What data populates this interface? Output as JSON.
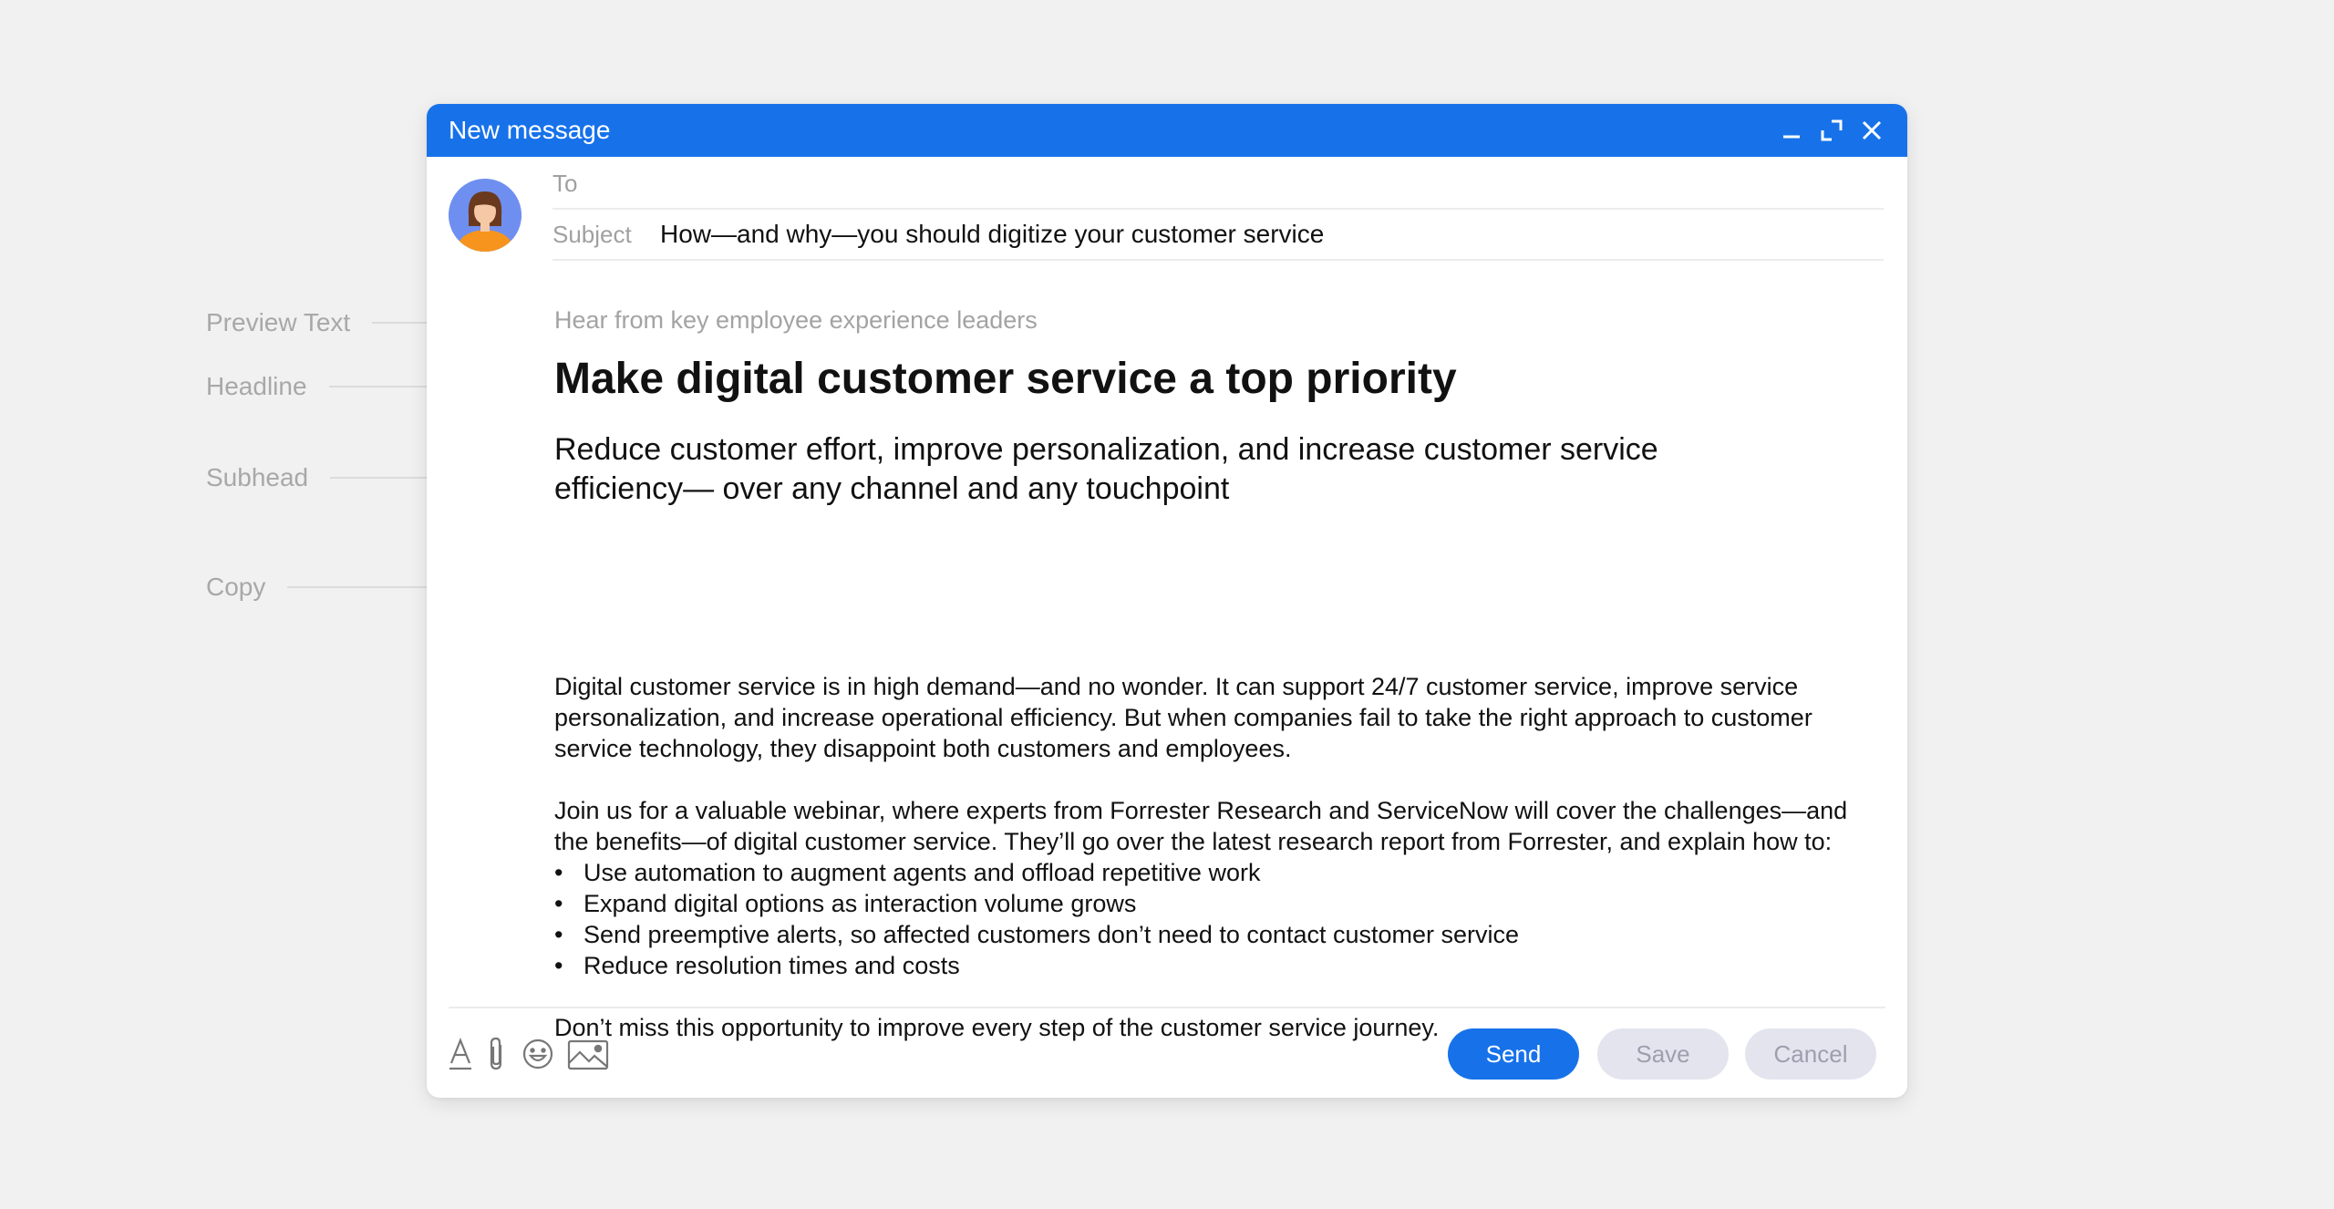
{
  "annotations": {
    "preview_text": "Preview Text",
    "headline": "Headline",
    "subhead": "Subhead",
    "copy": "Copy"
  },
  "window": {
    "title": "New message",
    "controls": [
      "minimize-icon",
      "expand-icon",
      "close-icon"
    ]
  },
  "fields": {
    "to_label": "To",
    "to_value": "",
    "subject_label": "Subject",
    "subject_value": "How—and why—you should digitize your customer service"
  },
  "email": {
    "preview_text": "Hear from key employee experience leaders",
    "headline": "Make digital customer service a top priority",
    "subhead": "Reduce customer effort, improve personalization, and increase customer service efficiency— over any channel and any touchpoint",
    "copy": {
      "p1": "Digital customer service is in high demand—and no wonder. It can support 24/7 customer service, improve service personalization, and increase operational efficiency. But when companies fail to take the right approach to customer service technology, they disappoint both customers and employees.",
      "p2": "Join us for a valuable webinar, where experts from Forrester Research and ServiceNow will cover the challenges—and the benefits—of digital customer service. They’ll go over the latest research report from Forrester, and explain how to:",
      "bullets": [
        "Use automation to augment agents and offload repetitive work",
        "Expand digital options as interaction volume grows",
        "Send preemptive alerts, so affected customers don’t need to contact customer service",
        "Reduce resolution times and costs"
      ],
      "p3": "Don’t miss this opportunity to improve every step of the customer service journey."
    }
  },
  "toolbar": {
    "icons": [
      "text-format-icon",
      "attachment-icon",
      "emoji-icon",
      "image-icon"
    ]
  },
  "buttons": {
    "send": "Send",
    "save": "Save",
    "cancel": "Cancel"
  },
  "colors": {
    "accent": "#1772ea",
    "secondary_button_bg": "#e3e4ee",
    "secondary_button_text": "#9c9fae",
    "annotation_text": "#a8a8a8"
  }
}
